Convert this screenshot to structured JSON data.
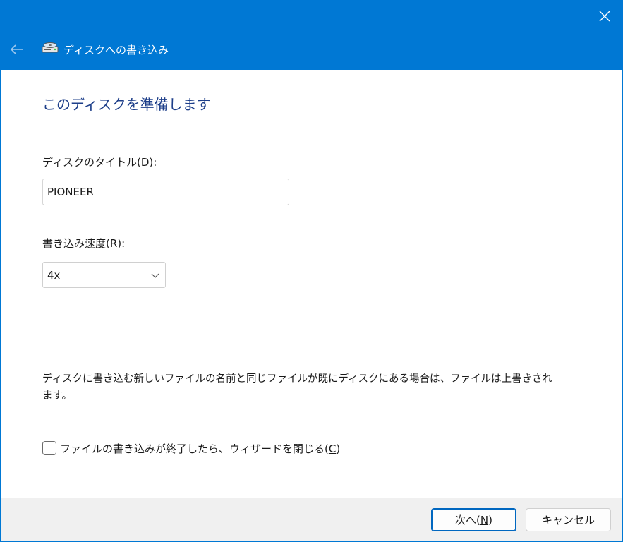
{
  "window": {
    "title": "ディスクへの書き込み",
    "back_icon": "back-arrow-icon",
    "close_icon": "close-icon",
    "app_icon": "disc-drive-icon",
    "accent_color": "#0078d4"
  },
  "main": {
    "heading": "このディスクを準備します",
    "disc_title": {
      "label_prefix": "ディスクのタイトル(",
      "accel": "D",
      "label_suffix": "):",
      "value": "PIONEER"
    },
    "write_speed": {
      "label_prefix": "書き込み速度(",
      "accel": "R",
      "label_suffix": "):",
      "selected": "4x"
    },
    "info_text": "ディスクに書き込む新しいファイルの名前と同じファイルが既にディスクにある場合は、ファイルは上書きされます。",
    "close_wizard_checkbox": {
      "label_prefix": "ファイルの書き込みが終了したら、ウィザードを閉じる(",
      "accel": "C",
      "label_suffix": ")",
      "checked": false
    }
  },
  "footer": {
    "next_button": {
      "label_prefix": "次へ(",
      "accel": "N",
      "label_suffix": ")"
    },
    "cancel_button": {
      "label": "キャンセル"
    }
  }
}
